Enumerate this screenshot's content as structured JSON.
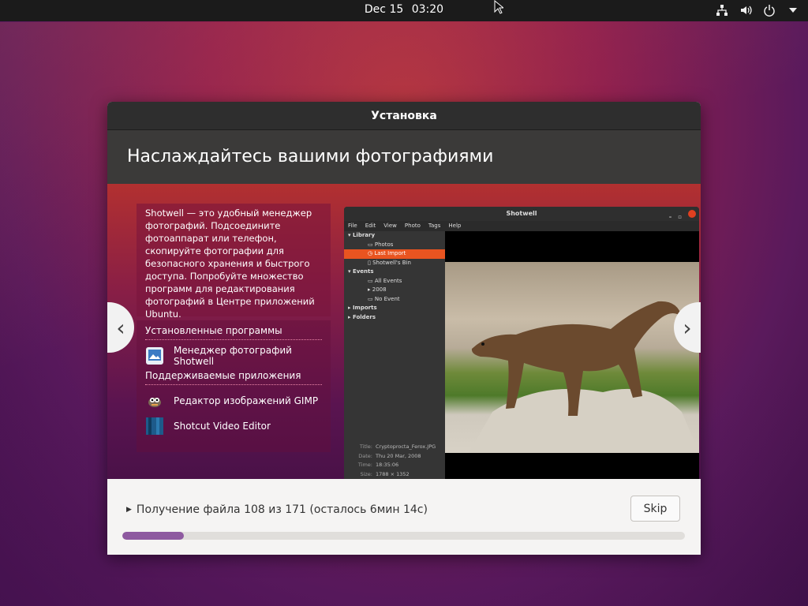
{
  "topbar": {
    "date": "Dec 15",
    "time": "03:20",
    "icons": [
      "network-icon",
      "volume-icon",
      "power-icon",
      "menu-arrow-icon"
    ]
  },
  "dialog": {
    "title": "Установка",
    "header": "Наслаждайтесь вашими фотографиями"
  },
  "slide": {
    "description": "Shotwell — это удобный менеджер фотографий. Подсоедините фотоаппарат или телефон, скопируйте фотографии для безопасного хранения и быстрого доступа. Попробуйте множество программ для редактирования фотографий в Центре приложений Ubuntu.",
    "installed_title": "Установленные программы",
    "installed_apps": [
      {
        "name": "Менеджер фотографий Shotwell",
        "icon": "shotwell-icon"
      }
    ],
    "supported_title": "Поддерживаемые приложения",
    "supported_apps": [
      {
        "name": "Редактор изображений GIMP",
        "icon": "gimp-icon"
      },
      {
        "name": "Shotcut Video Editor",
        "icon": "shotcut-icon"
      }
    ],
    "prev_arrow": "‹",
    "next_arrow": "›",
    "screenshot": {
      "title": "Shotwell",
      "menu": [
        "File",
        "Edit",
        "View",
        "Photo",
        "Tags",
        "Help"
      ],
      "tree": {
        "library": "Library",
        "photos": "Photos",
        "last_import": "Last Import",
        "shotwells_bin": "Shotwell's Bin",
        "events": "Events",
        "all_events": "All Events",
        "year": "2008",
        "no_event": "No Event",
        "imports": "Imports",
        "folders": "Folders"
      },
      "meta": {
        "title_k": "Title:",
        "title_v": "Cryptoprocta_Ferox.JPG",
        "date_k": "Date:",
        "date_v": "Thu 20 Mar, 2008",
        "time_k": "Time:",
        "time_v": "18:35:06",
        "size_k": "Size:",
        "size_v": "1788 × 1352"
      }
    }
  },
  "footer": {
    "status": "Получение файла 108 из 171 (осталось 6мин 14с)",
    "skip_label": "Skip",
    "progress_fraction": 0.11
  },
  "colors": {
    "accent_orange": "#e95420",
    "progress_purple": "#8e5aa0"
  }
}
